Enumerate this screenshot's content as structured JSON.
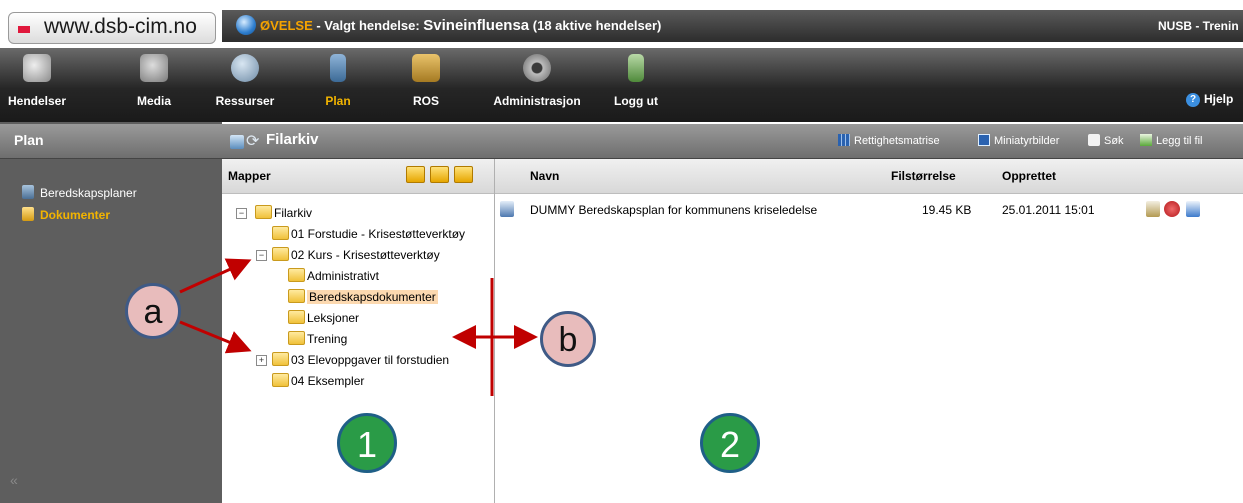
{
  "browser": {
    "url": "www.dsb-cim.no"
  },
  "event": {
    "prefix": "ØVELSE",
    "label": " - Valgt hendelse: ",
    "name": "Svineinfluensa",
    "count": " (18 aktive hendelser)"
  },
  "user": {
    "label": "NUSB - Trenin"
  },
  "nav": {
    "items": [
      {
        "label": "Hendelser",
        "icon": "hendelser-icon"
      },
      {
        "label": "Media",
        "icon": "media-icon"
      },
      {
        "label": "Ressurser",
        "icon": "ressurser-icon"
      },
      {
        "label": "Plan",
        "icon": "plan-icon",
        "active": true
      },
      {
        "label": "ROS",
        "icon": "ros-icon"
      },
      {
        "label": "Administrasjon",
        "icon": "gear-icon"
      },
      {
        "label": "Logg ut",
        "icon": "logout-icon"
      }
    ],
    "help": "Hjelp"
  },
  "sidebar": {
    "title": "Plan",
    "items": [
      {
        "label": "Beredskapsplaner"
      },
      {
        "label": "Dokumenter",
        "active": true
      }
    ]
  },
  "content": {
    "title": "Filarkiv",
    "toolbar": {
      "rights": "Rettighetsmatrise",
      "thumbs": "Miniatyrbilder",
      "search": "Søk",
      "add": "Legg til fil"
    }
  },
  "folders": {
    "header": "Mapper",
    "tree": {
      "root": "Filarkiv",
      "n01": "01 Forstudie - Krisestøtteverktøy",
      "n02": "02 Kurs - Krisestøtteverktøy",
      "n02a": "Administrativt",
      "n02b": "Beredskapsdokumenter",
      "n02c": "Leksjoner",
      "n02d": "Trening",
      "n03": "03 Elevoppgaver til forstudien",
      "n04": "04 Eksempler"
    }
  },
  "files": {
    "columns": {
      "name": "Navn",
      "size": "Filstørrelse",
      "created": "Opprettet"
    },
    "rows": [
      {
        "name": "DUMMY Beredskapsplan for kommunens kriseledelse",
        "size": "19.45 KB",
        "created": "25.01.2011 15:01"
      }
    ]
  },
  "annotations": {
    "a": "a",
    "b": "b",
    "one": "1",
    "two": "2"
  },
  "colors": {
    "accent": "#f2b400",
    "annotation_arrow": "#c00000",
    "annotation_green": "#2a9b47"
  }
}
